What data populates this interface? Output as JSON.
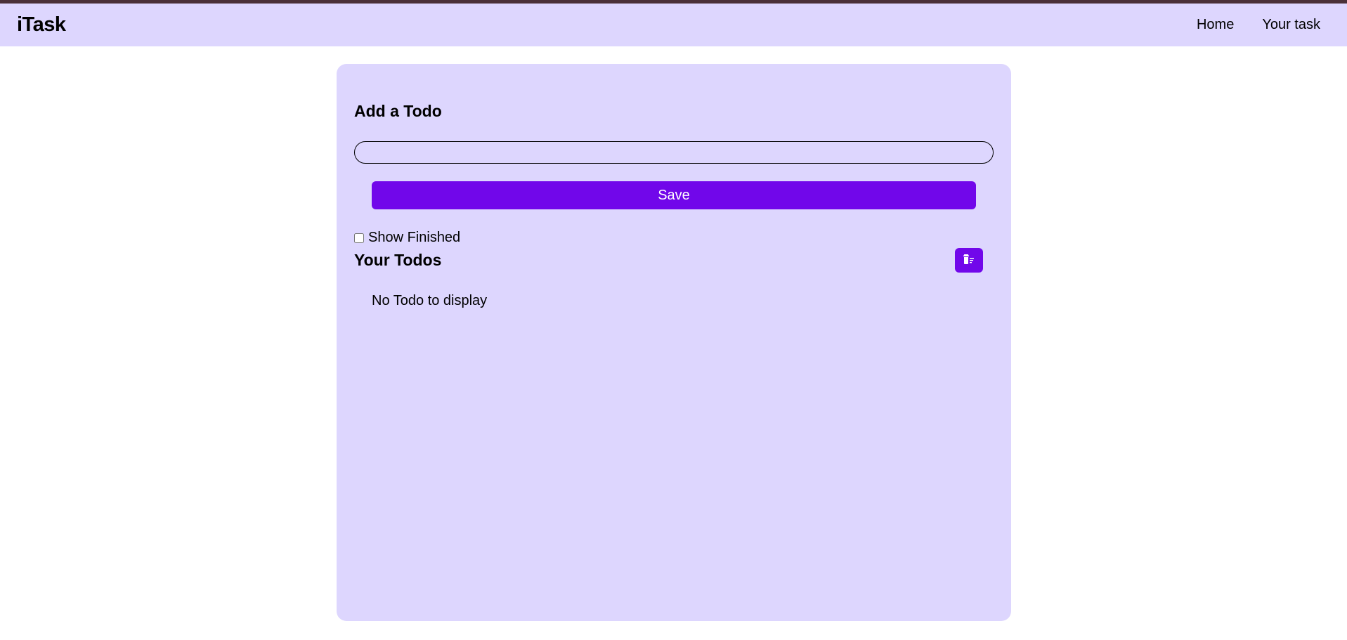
{
  "navbar": {
    "brand": "iTask",
    "links": [
      {
        "label": "Home"
      },
      {
        "label": "Your task"
      }
    ]
  },
  "form": {
    "title": "Add a Todo",
    "input_value": "",
    "input_placeholder": "",
    "save_label": "Save"
  },
  "filters": {
    "show_finished_label": "Show Finished",
    "show_finished_checked": false
  },
  "todos": {
    "title": "Your Todos",
    "clear_icon": "trash-icon",
    "empty_message": "No Todo to display",
    "items": []
  },
  "colors": {
    "accent": "#7107ea",
    "panel": "#ddd6fe",
    "top_strip": "#4a3038"
  }
}
